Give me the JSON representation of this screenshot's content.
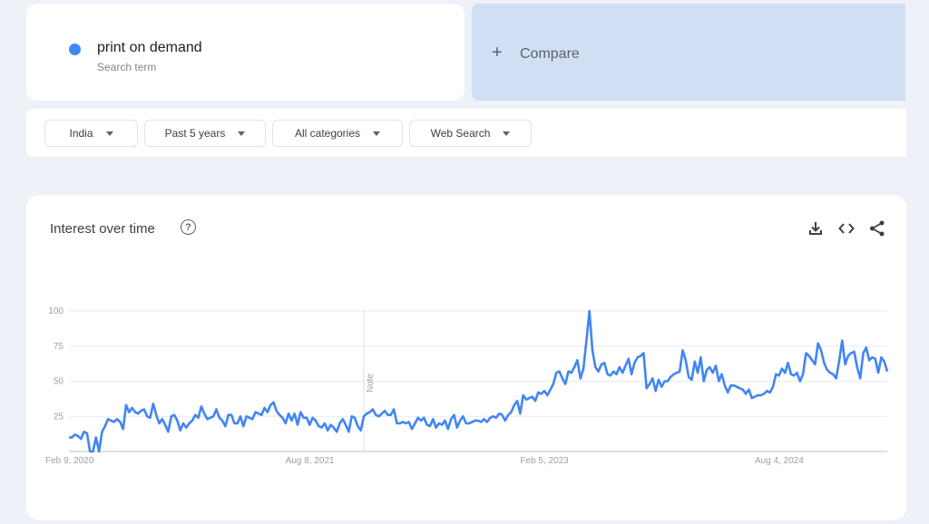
{
  "search_term": {
    "name": "print on demand",
    "subtitle": "Search term",
    "color": "#4285f4"
  },
  "compare": {
    "icon": "plus-icon",
    "label": "Compare"
  },
  "filters": [
    {
      "label": "India"
    },
    {
      "label": "Past 5 years"
    },
    {
      "label": "All categories"
    },
    {
      "label": "Web Search"
    }
  ],
  "panel": {
    "title": "Interest over time",
    "help_icon": "question-circle-icon",
    "actions": [
      "download-icon",
      "embed-code-icon",
      "share-icon"
    ]
  },
  "chart_data": {
    "type": "line",
    "title": "Interest over time",
    "xlabel": "",
    "ylabel": "",
    "ylim": [
      0,
      100
    ],
    "yticks": [
      25,
      50,
      75,
      100
    ],
    "grid": true,
    "xtick_labels": [
      "Feb 9, 2020",
      "Aug 8, 2021",
      "Feb 5, 2023",
      "Aug 4, 2024"
    ],
    "xtick_week_index": [
      0,
      78,
      156,
      234
    ],
    "annotation": {
      "label": "Note",
      "week_index": 98
    },
    "series": [
      {
        "name": "print on demand",
        "color": "#4285f4",
        "frequency": "weekly",
        "start": "Feb 9, 2020",
        "values": [
          10,
          10,
          12,
          11,
          9,
          14,
          13,
          0,
          0,
          10,
          0,
          14,
          18,
          23,
          22,
          21,
          23,
          21,
          16,
          33,
          28,
          31,
          28,
          27,
          29,
          30,
          25,
          24,
          34,
          26,
          20,
          23,
          19,
          14,
          25,
          26,
          22,
          15,
          20,
          17,
          20,
          22,
          26,
          24,
          32,
          27,
          23,
          24,
          25,
          30,
          24,
          22,
          18,
          26,
          26,
          20,
          20,
          25,
          18,
          25,
          24,
          23,
          28,
          27,
          26,
          31,
          28,
          33,
          35,
          29,
          26,
          24,
          20,
          27,
          22,
          27,
          19,
          28,
          24,
          24,
          19,
          24,
          22,
          18,
          17,
          20,
          15,
          19,
          17,
          14,
          20,
          23,
          19,
          14,
          25,
          24,
          18,
          15,
          25,
          27,
          28,
          30,
          26,
          25,
          27,
          29,
          26,
          26,
          30,
          20,
          20,
          21,
          20,
          21,
          16,
          20,
          24,
          22,
          24,
          19,
          18,
          23,
          17,
          20,
          19,
          22,
          16,
          23,
          26,
          17,
          22,
          25,
          20,
          20,
          21,
          22,
          22,
          21,
          23,
          21,
          24,
          25,
          24,
          27,
          26,
          22,
          26,
          28,
          33,
          36,
          27,
          40,
          37,
          38,
          39,
          36,
          42,
          41,
          43,
          40,
          44,
          48,
          56,
          57,
          52,
          48,
          57,
          56,
          60,
          65,
          52,
          59,
          79,
          100,
          72,
          60,
          57,
          62,
          63,
          55,
          54,
          57,
          55,
          60,
          56,
          61,
          66,
          55,
          63,
          67,
          68,
          70,
          45,
          48,
          52,
          43,
          51,
          46,
          50,
          50,
          53,
          55,
          56,
          57,
          72,
          65,
          53,
          51,
          64,
          56,
          67,
          50,
          58,
          60,
          56,
          61,
          50,
          55,
          47,
          42,
          47,
          47,
          46,
          45,
          44,
          41,
          44,
          38,
          39,
          40,
          40,
          41,
          43,
          42,
          46,
          55,
          54,
          59,
          56,
          63,
          55,
          54,
          56,
          50,
          55,
          70,
          68,
          65,
          62,
          77,
          72,
          63,
          58,
          56,
          55,
          52,
          64,
          79,
          62,
          68,
          70,
          71,
          60,
          52,
          70,
          74,
          65,
          67,
          66,
          56,
          67,
          64,
          57
        ]
      }
    ]
  }
}
